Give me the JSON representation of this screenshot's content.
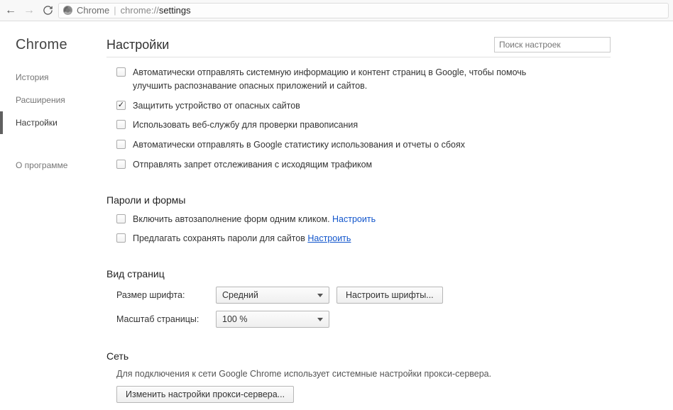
{
  "toolbar": {
    "chrome_label": "Chrome",
    "url_scheme": "chrome://",
    "url_path": "settings"
  },
  "sidebar": {
    "brand": "Chrome",
    "items": [
      {
        "label": "История"
      },
      {
        "label": "Расширения"
      },
      {
        "label": "Настройки",
        "active": true
      }
    ],
    "about": "О программе"
  },
  "header": {
    "title": "Настройки",
    "faded": "",
    "search_placeholder": "Поиск настроек"
  },
  "privacy_opts": [
    {
      "checked": false,
      "label": "Автоматически отправлять системную информацию и контент страниц в Google, чтобы помочь улучшить распознавание опасных приложений и сайтов."
    },
    {
      "checked": true,
      "label": "Защитить устройство от опасных сайтов"
    },
    {
      "checked": false,
      "label": "Использовать веб-службу для проверки правописания"
    },
    {
      "checked": false,
      "label": "Автоматически отправлять в Google статистику использования и отчеты о сбоях"
    },
    {
      "checked": false,
      "label": "Отправлять запрет отслеживания с исходящим трафиком"
    }
  ],
  "passwords": {
    "title": "Пароли и формы",
    "opt1": {
      "checked": false,
      "label": "Включить автозаполнение форм одним кликом.",
      "link": "Настроить"
    },
    "opt2": {
      "checked": false,
      "label": "Предлагать сохранять пароли для сайтов",
      "link": "Настроить"
    }
  },
  "pageview": {
    "title": "Вид страниц",
    "font_label": "Размер шрифта:",
    "font_value": "Средний",
    "configure_fonts": "Настроить шрифты...",
    "zoom_label": "Масштаб страницы:",
    "zoom_value": "100 %"
  },
  "network": {
    "title": "Сеть",
    "desc": "Для подключения к сети Google Chrome использует системные настройки прокси-сервера.",
    "proxy_btn": "Изменить настройки прокси-сервера..."
  }
}
